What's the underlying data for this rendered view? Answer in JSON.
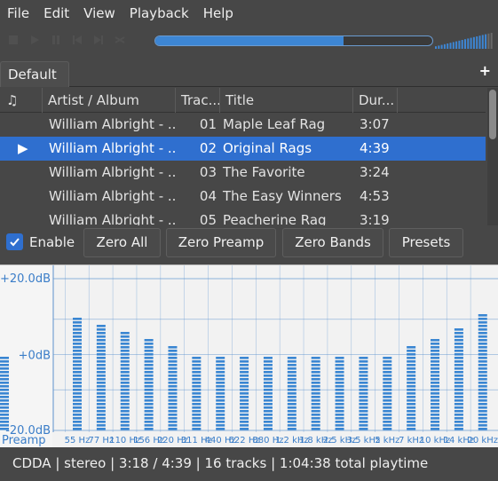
{
  "menu": [
    "File",
    "Edit",
    "View",
    "Playback",
    "Help"
  ],
  "toolbar": {
    "buttons": [
      "stop-icon",
      "play-icon",
      "pause-icon",
      "previous-icon",
      "next-icon",
      "random-icon"
    ],
    "seek_progress": 0.68,
    "volume_level": 0.9
  },
  "tabs": {
    "default_label": "Default",
    "add_label": "+"
  },
  "playlist": {
    "columns": {
      "icon": "♫",
      "artist": "Artist / Album",
      "track": "Trac...",
      "title": "Title",
      "duration": "Dur..."
    },
    "rows": [
      {
        "playing": "",
        "artist": "William Albright - ...",
        "track": "01",
        "title": "Maple Leaf Rag",
        "duration": "3:07"
      },
      {
        "playing": "▶",
        "artist": "William Albright - ...",
        "track": "02",
        "title": "Original Rags",
        "duration": "4:39"
      },
      {
        "playing": "",
        "artist": "William Albright - ...",
        "track": "03",
        "title": "The Favorite",
        "duration": "3:24"
      },
      {
        "playing": "",
        "artist": "William Albright - ...",
        "track": "04",
        "title": "The Easy Winners",
        "duration": "4:53"
      },
      {
        "playing": "",
        "artist": "William Albright - ...",
        "track": "05",
        "title": "Peacherine Rag",
        "duration": "3:19"
      }
    ],
    "selected_index": 1
  },
  "equalizer": {
    "enable_label": "Enable",
    "enabled": true,
    "buttons": {
      "zero_all": "Zero All",
      "zero_preamp": "Zero Preamp",
      "zero_bands": "Zero Bands",
      "presets": "Presets"
    },
    "db_labels": {
      "top": "+20.0dB",
      "mid": "+0dB",
      "bottom": "-20.0dB"
    },
    "preamp_label": "Preamp",
    "preamp_db": 0,
    "bands": [
      {
        "label": "55 Hz",
        "db": 10
      },
      {
        "label": "77 Hz",
        "db": 8.5
      },
      {
        "label": "110 Hz",
        "db": 6
      },
      {
        "label": "156 Hz",
        "db": 4.5
      },
      {
        "label": "220 Hz",
        "db": 3
      },
      {
        "label": "311 Hz",
        "db": 0
      },
      {
        "label": "440 Hz",
        "db": 0
      },
      {
        "label": "622 Hz",
        "db": 0
      },
      {
        "label": "880 Hz",
        "db": 0
      },
      {
        "label": "1.2 kHz",
        "db": 0
      },
      {
        "label": "1.8 kHz",
        "db": 0
      },
      {
        "label": "2.5 kHz",
        "db": 0
      },
      {
        "label": "3.5 kHz",
        "db": 0
      },
      {
        "label": "5 kHz",
        "db": 0
      },
      {
        "label": "7 kHz",
        "db": 3
      },
      {
        "label": "10 kHz",
        "db": 4.5
      },
      {
        "label": "14 kHz",
        "db": 7.5
      },
      {
        "label": "20 kHz",
        "db": 11
      }
    ],
    "colors": {
      "bar": "#3a86d2",
      "grid": "#5d93cf",
      "label": "#3a7dc8"
    }
  },
  "status": {
    "text": "CDDA | stereo | 3:18 / 4:39 | 16 tracks | 1:04:38 total playtime"
  }
}
